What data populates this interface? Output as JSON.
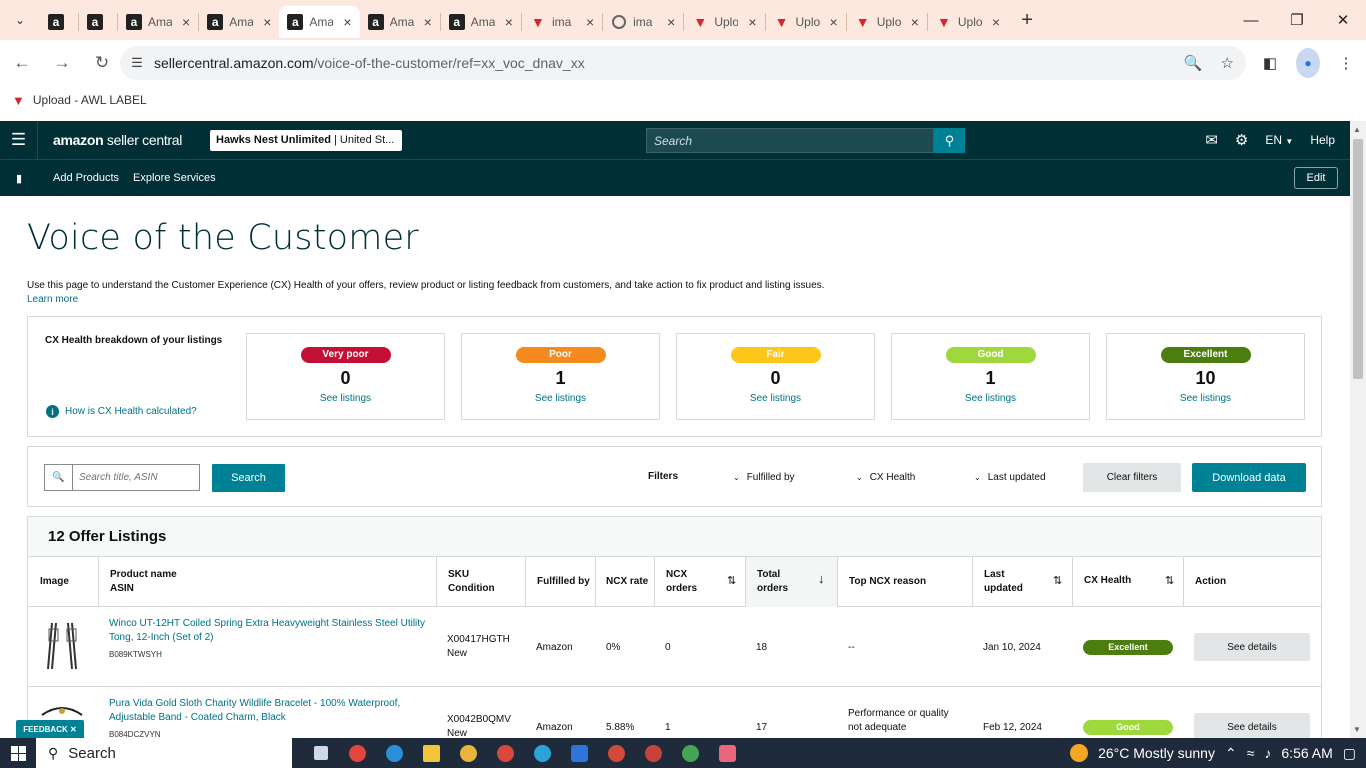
{
  "browser": {
    "tabs": [
      {
        "icon": "amazon-icon",
        "title": ""
      },
      {
        "icon": "amazon-icon",
        "title": ""
      },
      {
        "icon": "amazon-icon",
        "title": "Ama"
      },
      {
        "icon": "amazon-icon",
        "title": "Ama"
      },
      {
        "icon": "amazon-icon",
        "title": "Ama",
        "active": true
      },
      {
        "icon": "amazon-icon",
        "title": "Ama"
      },
      {
        "icon": "amazon-icon",
        "title": "Ama"
      },
      {
        "icon": "triangle-logo-icon",
        "title": "ima"
      },
      {
        "icon": "circle-logo-icon",
        "title": "ima"
      },
      {
        "icon": "triangle-logo-icon",
        "title": "Uplo"
      },
      {
        "icon": "triangle-logo-icon",
        "title": "Uplo"
      },
      {
        "icon": "triangle-logo-icon",
        "title": "Uplo"
      },
      {
        "icon": "triangle-logo-icon",
        "title": "Uplo"
      }
    ],
    "url_host": "sellercentral.amazon.com",
    "url_path": "/voice-of-the-customer/ref=xx_voc_dnav_xx",
    "bookmark": "Upload - AWL LABEL"
  },
  "header": {
    "logo_bold": "amazon",
    "logo_rest": " seller central",
    "account_name": "Hawks Nest Unlimited",
    "account_region": " | United St...",
    "search_placeholder": "Search",
    "lang": "EN",
    "help": "Help"
  },
  "subnav": {
    "links": [
      "Add Products",
      "Explore Services"
    ],
    "edit": "Edit"
  },
  "page": {
    "title": "Voice of the Customer",
    "description": "Use this page to understand the Customer Experience (CX) Health of your offers, review product or listing feedback from customers, and take action to fix product and listing issues.",
    "learn_more": "Learn more"
  },
  "health": {
    "label": "CX Health breakdown of your listings",
    "how_link": "How is CX Health calculated?",
    "see_listings": "See listings",
    "boxes": [
      {
        "label": "Very poor",
        "count": "0",
        "color": "#c40f36",
        "text_color": "#ffffff"
      },
      {
        "label": "Poor",
        "count": "1",
        "color": "#f58a1f",
        "text_color": "#ffffff"
      },
      {
        "label": "Fair",
        "count": "0",
        "color": "#ffc61a",
        "text_color": "#ffffff"
      },
      {
        "label": "Good",
        "count": "1",
        "color": "#9fd83c",
        "text_color": "#ffffff"
      },
      {
        "label": "Excellent",
        "count": "10",
        "color": "#4b7d0f",
        "text_color": "#ffffff"
      }
    ]
  },
  "filters": {
    "search_placeholder": "Search title, ASIN",
    "search_button": "Search",
    "label": "Filters",
    "dropdowns": [
      "Fulfilled by",
      "CX Health",
      "Last updated"
    ],
    "clear": "Clear filters",
    "download": "Download data"
  },
  "listings": {
    "heading": "12 Offer Listings",
    "columns": {
      "image": "Image",
      "product_name": "Product name",
      "asin": "ASIN",
      "sku": "SKU",
      "condition": "Condition",
      "fulfilled_by": "Fulfilled by",
      "ncx_rate": "NCX rate",
      "ncx_orders_1": "NCX",
      "ncx_orders_2": "orders",
      "total_orders_1": "Total",
      "total_orders_2": "orders",
      "top_reason": "Top NCX reason",
      "last_updated_1": "Last",
      "last_updated_2": "updated",
      "cx_health": "CX Health",
      "action": "Action"
    },
    "rows": [
      {
        "name": "Winco UT-12HT Coiled Spring Extra Heavyweight Stainless Steel Utility Tong, 12-Inch (Set of 2)",
        "asin": "B089KTWSYH",
        "sku": "X00417HGTH",
        "condition": "New",
        "fulfilled_by": "Amazon",
        "ncx_rate": "0%",
        "ncx_orders": "0",
        "total_orders": "18",
        "top_reason": "--",
        "top_reason_2": "",
        "last_updated": "Jan 10, 2024",
        "health": "Excellent",
        "health_color": "#4b7d0f",
        "action": "See details"
      },
      {
        "name": "Pura Vida Gold Sloth Charity Wildlife Bracelet - 100% Waterproof, Adjustable Band - Coated Charm, Black",
        "asin": "B084DCZVYN",
        "sku": "X0042B0QMV",
        "condition": "New",
        "fulfilled_by": "Amazon",
        "ncx_rate": "5.88%",
        "ncx_orders": "1",
        "total_orders": "17",
        "top_reason": "Performance or quality",
        "top_reason_2": "not adequate",
        "last_updated": "Feb 12, 2024",
        "health": "Good",
        "health_color": "#9fd83c",
        "action": "See details"
      }
    ]
  },
  "feedback": "FEEDBACK",
  "taskbar": {
    "search": "Search",
    "weather": "26°C  Mostly sunny",
    "time": "6:56 AM"
  }
}
